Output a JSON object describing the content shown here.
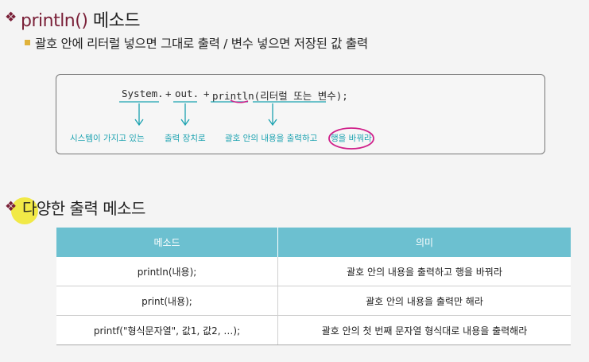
{
  "heading1": {
    "keyword": "println()",
    "rest": " 메소드"
  },
  "subtitle": "괄호 안에 리터럴 넣으면 그대로 출력 / 변수 넣으면 저장된 값 출력",
  "code": {
    "system": "System.",
    "plus1": "+",
    "out": "out.",
    "plus2": "+",
    "println": "println(리터럴 또는 변수);"
  },
  "annotations": {
    "system": "시스템이 가지고 있는",
    "out": "출력 장치로",
    "println": "괄호 안의 내용을 출력하고",
    "newline": "행을 바꿔라"
  },
  "heading2": "다양한 출력 메소드",
  "table": {
    "headers": [
      "메소드",
      "의미"
    ],
    "rows": [
      [
        "println(내용);",
        "괄호 안의 내용을 출력하고 행을 바꿔라"
      ],
      [
        "print(내용);",
        "괄호 안의 내용을 출력만 해라"
      ],
      [
        "printf(\"형식문자열\", 값1, 값2, …);",
        "괄호 안의 첫 번째 문자열 형식대로 내용을 출력해라"
      ]
    ]
  },
  "colors": {
    "accent": "#7a2038",
    "annotation": "#1ba2b0",
    "header": "#6cc0d0",
    "circle": "#d0208a",
    "bullet": "#e0b23a"
  }
}
